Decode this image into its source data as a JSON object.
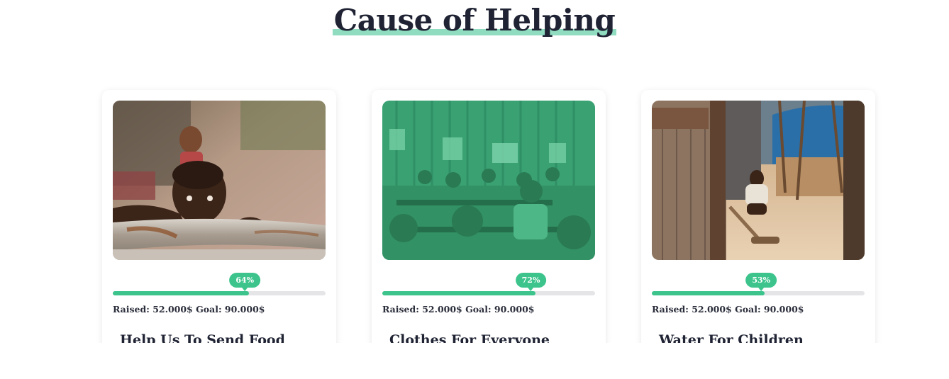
{
  "section": {
    "title": "Cause of Helping"
  },
  "colors": {
    "accent": "#3cc48c",
    "title_underline": "#8fdcc0",
    "track": "#e5e5e8",
    "text": "#1f2333"
  },
  "causes": [
    {
      "image": "boy-leaning-on-rusty-railing-photo",
      "progress_percent": 64,
      "progress_label": "64%",
      "raised_text": "Raised: 52.000$ Goal: 90.000$",
      "title": "Help Us To Send Food"
    },
    {
      "image": "classroom-children-green-tinted-photo",
      "progress_percent": 72,
      "progress_label": "72%",
      "raised_text": "Raised: 52.000$ Goal: 90.000$",
      "title": "Clothes For Everyone"
    },
    {
      "image": "child-crouching-by-wooden-shack-photo",
      "progress_percent": 53,
      "progress_label": "53%",
      "raised_text": "Raised: 52.000$ Goal: 90.000$",
      "title": "Water For Children"
    }
  ]
}
